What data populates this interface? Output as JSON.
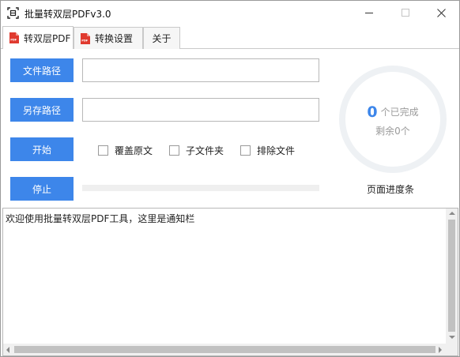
{
  "window": {
    "title": "批量转双层PDFv3.0"
  },
  "tabs": [
    {
      "label": "转双层PDF",
      "icon": "pdf-icon",
      "active": true
    },
    {
      "label": "转换设置",
      "icon": "pdf-icon",
      "active": false
    },
    {
      "label": "关于",
      "active": false
    }
  ],
  "main": {
    "file_path_button": "文件路径",
    "file_path_value": "",
    "save_path_button": "另存路径",
    "save_path_value": "",
    "start_button": "开始",
    "stop_button": "停止",
    "options": [
      {
        "label": "覆盖原文",
        "checked": false
      },
      {
        "label": "子文件夹",
        "checked": false
      },
      {
        "label": "排除文件",
        "checked": false
      }
    ],
    "progress": 0
  },
  "status_ring": {
    "completed_count": "0",
    "completed_label": "个已完成",
    "remaining_text": "剩余0个",
    "caption": "页面进度条"
  },
  "log": {
    "text": "欢迎使用批量转双层PDF工具，这里是通知栏"
  },
  "colors": {
    "accent": "#3d86ea",
    "ring": "#eef1f4"
  }
}
